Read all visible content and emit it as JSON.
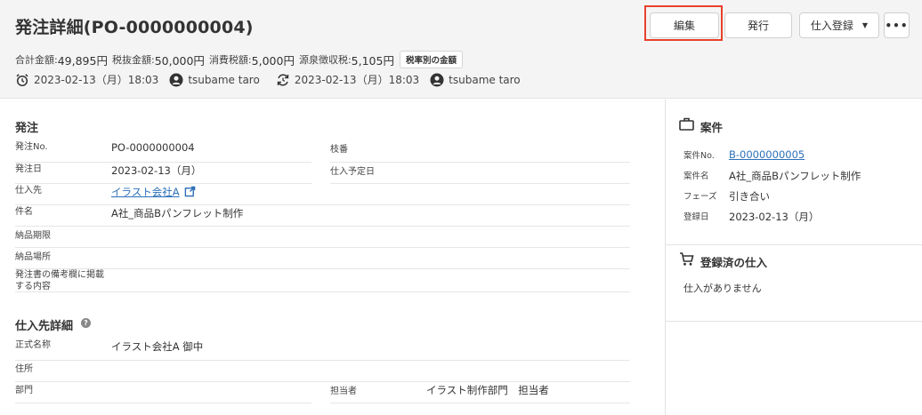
{
  "header": {
    "title": "発注詳細(PO-0000000004)",
    "amounts": [
      {
        "label": "合計金額:",
        "value": "49,895円"
      },
      {
        "label": "税抜金額:",
        "value": "50,000円"
      },
      {
        "label": "消費税額:",
        "value": "5,000円"
      },
      {
        "label": "源泉徴収税:",
        "value": "5,105円"
      }
    ],
    "tax_badge": "税率別の金額",
    "created_at": "2023-02-13（月）18:03",
    "created_by": "tsubame taro",
    "updated_at": "2023-02-13（月）18:03",
    "updated_by": "tsubame taro"
  },
  "toolbar": {
    "edit_label": "編集",
    "issue_label": "発行",
    "register_label": "仕入登録",
    "more_label": "•••"
  },
  "order": {
    "section_title": "発注",
    "order_no_label": "発注No.",
    "order_no": "PO-0000000004",
    "branch_label": "枝番",
    "branch": "",
    "order_date_label": "発注日",
    "order_date": "2023-02-13（月）",
    "planned_label": "仕入予定日",
    "planned": "",
    "supplier_label": "仕入先",
    "supplier": "イラスト会社A",
    "subject_label": "件名",
    "subject": "A社_商品Bパンフレット制作",
    "deadline_label": "納品期限",
    "deadline": "",
    "place_label": "納品場所",
    "place": "",
    "remarks_label": "発注書の備考欄に掲載する内容",
    "remarks": ""
  },
  "supplier_detail": {
    "section_title": "仕入先詳細",
    "official_name_label": "正式名称",
    "official_name": "イラスト会社A 御中",
    "address_label": "住所",
    "address": "",
    "dept_label": "部門",
    "dept": "",
    "person_label": "担当者",
    "person": "イラスト制作部門　担当者"
  },
  "project": {
    "title": "案件",
    "no_label": "案件No.",
    "no": "B-0000000005",
    "name_label": "案件名",
    "name": "A社_商品Bパンフレット制作",
    "phase_label": "フェーズ",
    "phase": "引き合い",
    "date_label": "登録日",
    "date": "2023-02-13（月）"
  },
  "purchases": {
    "title": "登録済の仕入",
    "empty": "仕入がありません"
  },
  "colors": {
    "highlight": "#e8412c",
    "link": "#2c6fb8",
    "header_bg": "#f4f4f4"
  }
}
